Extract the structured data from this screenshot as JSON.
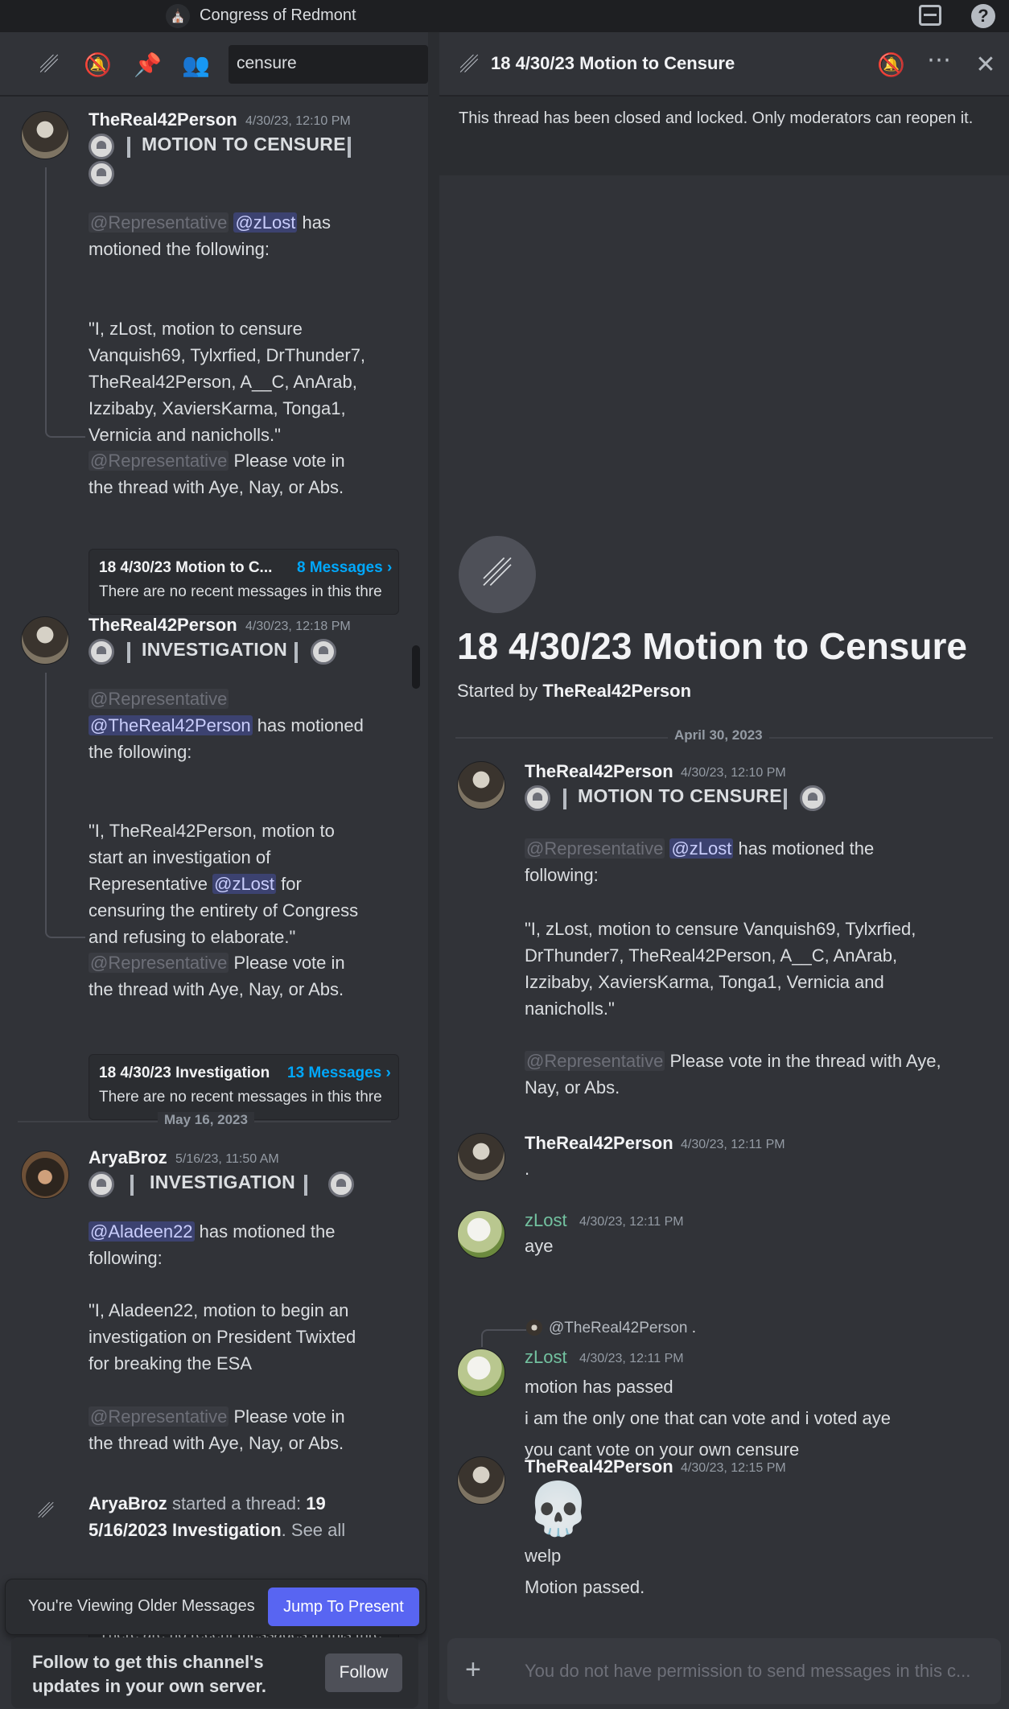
{
  "topbar": {
    "server_name": "Congress of Redmont",
    "inbox_icon": "inbox-icon",
    "help_icon": "help-icon",
    "help_glyph": "?"
  },
  "left": {
    "search_value": "censure",
    "messages": [
      {
        "author": "TheReal42Person",
        "timestamp": "4/30/23, 12:10 PM",
        "motion_title": "MOTION TO CENSURE",
        "mention_role": "@Representative",
        "mention_user": "@zLost",
        "line1_tail": "has",
        "line2": "motioned the following:",
        "quote": [
          "\"I, zLost, motion to censure",
          "Vanquish69, Tylxrfied, DrThunder7,",
          "TheReal42Person, A__C, AnArab,",
          "Izzibaby, XaviersKarma, Tonga1,",
          "Vernicia and nanicholls.\""
        ],
        "vote_role": "@Representative",
        "vote1": "Please vote in",
        "vote2": "the thread with Aye, Nay, or Abs.",
        "thread_name": "18 4/30/23 Motion to C...",
        "thread_count": "8 Messages ›",
        "thread_sub": "There are no recent messages in this thre"
      },
      {
        "author": "TheReal42Person",
        "timestamp": "4/30/23, 12:18 PM",
        "motion_title": "INVESTIGATION",
        "mention_role": "@Representative",
        "mention_user": "@TheReal42Person",
        "line_tail": "has motioned",
        "line2": "the following:",
        "quote1": "\"I, TheReal42Person, motion to",
        "quote2": "start an investigation of",
        "quote3_pre": "Representative",
        "quote3_mention": "@zLost",
        "quote3_post": "for",
        "quote4": "censuring the entirety of Congress",
        "quote5": "and refusing to elaborate.\"",
        "vote_role": "@Representative",
        "vote1": "Please vote in",
        "vote2": "the thread with Aye, Nay, or Abs.",
        "thread_name": "18 4/30/23 Investigation",
        "thread_count": "13 Messages ›",
        "thread_sub": "There are no recent messages in this thre"
      },
      {
        "date_divider": "May 16, 2023",
        "author": "AryaBroz",
        "timestamp": "5/16/23, 11:50 AM",
        "motion_title": "INVESTIGATION",
        "mention_user": "@Aladeen22",
        "line_tail": "has motioned the",
        "line2": "following:",
        "quote": [
          "\"I, Aladeen22, motion to begin an",
          "investigation on President Twixted",
          "for breaking the ESA"
        ],
        "vote_role": "@Representative",
        "vote1": "Please vote in",
        "vote2": "the thread with Aye, Nay, or Abs."
      },
      {
        "author": "AryaBroz",
        "action": "started a thread:",
        "thread_bold": "19",
        "thread_bold2": "5/16/2023 Investigation",
        "see_all": ". See all",
        "thread_sub": "There are no recent messages in this thre"
      }
    ],
    "older_label": "You're Viewing Older Messages",
    "jump_label": "Jump To Present",
    "follow_text_1": "Follow to get this channel's",
    "follow_text_2": "updates in your own server.",
    "follow_button": "Follow"
  },
  "right": {
    "header_title": "18 4/30/23 Motion to Censure",
    "closed_notice": "This thread has been closed and locked. Only moderators can reopen it.",
    "big_title": "18 4/30/23 Motion to Censure",
    "started_by_label": "Started by",
    "started_by_user": "TheReal42Person",
    "date_divider": "April 30, 2023",
    "msg1": {
      "author": "TheReal42Person",
      "timestamp": "4/30/23, 12:10 PM",
      "motion_title": "MOTION TO CENSURE",
      "mention_role": "@Representative",
      "mention_user": "@zLost",
      "line1_tail": "has motioned the",
      "line2": "following:",
      "quote": [
        "\"I, zLost, motion to censure Vanquish69, Tylxrfied,",
        "DrThunder7, TheReal42Person, A__C, AnArab,",
        "Izzibaby, XaviersKarma, Tonga1, Vernicia and",
        "nanicholls.\""
      ],
      "vote_role": "@Representative",
      "vote1": "Please vote in the thread with Aye,",
      "vote2": "Nay, or Abs."
    },
    "msg2": {
      "author": "TheReal42Person",
      "timestamp": "4/30/23, 12:11 PM",
      "text": "."
    },
    "msg3": {
      "author": "zLost",
      "timestamp": "4/30/23, 12:11 PM",
      "text": "aye"
    },
    "msg4": {
      "reply_to": "@TheReal42Person",
      "reply_text": ".",
      "author": "zLost",
      "timestamp": "4/30/23, 12:11 PM",
      "lines": [
        "motion has passed",
        "i am the only one that can vote and i voted aye",
        "you cant vote on your own censure"
      ]
    },
    "msg5": {
      "author": "TheReal42Person",
      "timestamp": "4/30/23, 12:15 PM",
      "emoji": "💀",
      "lines": [
        "welp",
        "Motion passed."
      ]
    },
    "composer_placeholder": "You do not have permission to send messages in this c...",
    "composer_plus": "+"
  }
}
